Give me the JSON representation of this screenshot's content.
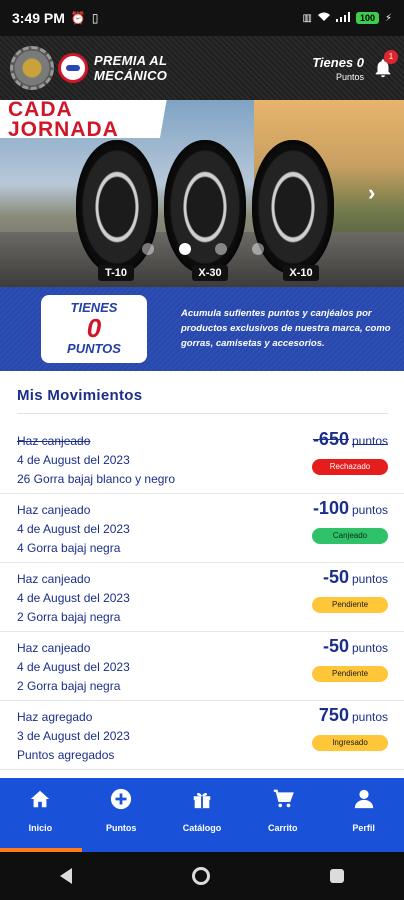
{
  "status_bar": {
    "time": "3:49 PM",
    "battery": "100"
  },
  "header": {
    "brand_line1": "PREMIA AL",
    "brand_line2": "MECÁNICO",
    "points_title": "Tienes 0",
    "points_sub": "Puntos",
    "notification_count": "1"
  },
  "banner": {
    "title_line1": "CADA",
    "title_line2": "JORNADA",
    "tires": [
      "T-10",
      "X-30",
      "X-10"
    ],
    "active_dot": 1
  },
  "points": {
    "label_top": "TIENES",
    "value": "0",
    "label_bottom": "PUNTOS",
    "description": "Acumula sufientes puntos y canjéalos por productos exclusivos de nuestra marca, como gorras, camisetas y accesorios."
  },
  "movements": {
    "title": "Mis Movimientos",
    "points_unit": "puntos",
    "items": [
      {
        "action": "Haz canjeado",
        "date": "4 de August del 2023",
        "detail": "26 Gorra bajaj blanco y negro",
        "amount": "-650",
        "status": "Rechazado"
      },
      {
        "action": "Haz canjeado",
        "date": "4 de August del 2023",
        "detail": "4 Gorra bajaj negra",
        "amount": "-100",
        "status": "Canjeado"
      },
      {
        "action": "Haz canjeado",
        "date": "4 de August del 2023",
        "detail": "2 Gorra bajaj negra",
        "amount": "-50",
        "status": "Pendiente"
      },
      {
        "action": "Haz canjeado",
        "date": "4 de August del 2023",
        "detail": "2 Gorra bajaj negra",
        "amount": "-50",
        "status": "Pendiente"
      },
      {
        "action": "Haz agregado",
        "date": "3 de August del 2023",
        "detail": "Puntos agregados",
        "amount": "750",
        "status": "Ingresado"
      }
    ]
  },
  "bottom_nav": {
    "items": [
      {
        "label": "Inicio",
        "icon": "home-icon"
      },
      {
        "label": "Puntos",
        "icon": "plus-circle-icon"
      },
      {
        "label": "Catálogo",
        "icon": "gift-icon"
      },
      {
        "label": "Carrito",
        "icon": "cart-icon"
      },
      {
        "label": "Perfil",
        "icon": "person-icon"
      }
    ],
    "active_index": 0
  },
  "colors": {
    "primary_blue": "#1952d9",
    "brand_red": "#d0172a",
    "status_rechazado": "#e51d1d",
    "status_canjeado": "#2fc26a",
    "status_pendiente": "#ffc63a"
  }
}
